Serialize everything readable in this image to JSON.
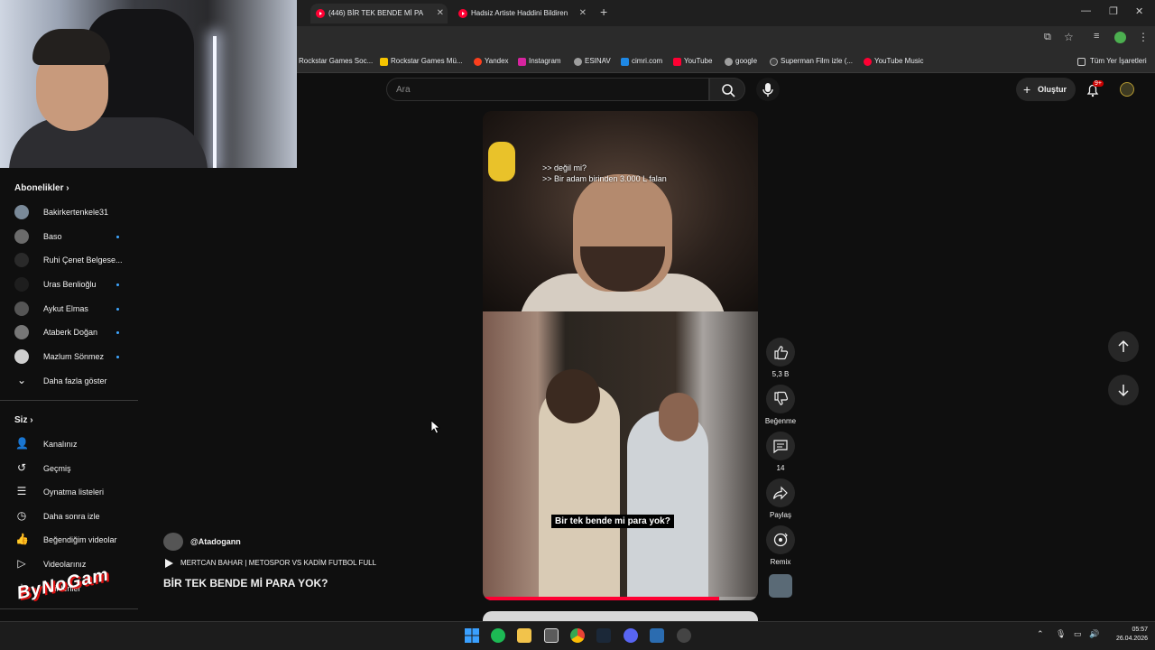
{
  "browser": {
    "tabs": [
      {
        "label": "(446) BİR TEK BENDE Mİ PA",
        "active": true
      },
      {
        "label": "Hadsiz Artiste Haddini Bildiren",
        "active": false
      }
    ],
    "bookmarks": [
      {
        "label": "Rockstar Games Soc...",
        "color": "#333333"
      },
      {
        "label": "Rockstar Games Mü...",
        "color": "#f5c400"
      },
      {
        "label": "Yandex",
        "color": "#fc3f1d"
      },
      {
        "label": "Instagram",
        "color": "#d6249f"
      },
      {
        "label": "ESINAV",
        "color": "#9e9e9e"
      },
      {
        "label": "cimri.com",
        "color": "#1e88e5"
      },
      {
        "label": "YouTube",
        "color": "#ff0033"
      },
      {
        "label": "google",
        "color": "#9e9e9e"
      },
      {
        "label": "Superman Film izle (...",
        "color": "#444444"
      },
      {
        "label": "YouTube Music",
        "color": "#ff0033"
      }
    ],
    "all_bookmarks": "Tüm Yer İşaretleri"
  },
  "sidebar": {
    "subscriptions_header": "Abonelikler",
    "subscriptions": [
      {
        "name": "Bakirkertenkele31",
        "new": false
      },
      {
        "name": "Baso",
        "new": true
      },
      {
        "name": "Ruhi Çenet Belgese...",
        "new": false
      },
      {
        "name": "Uras Benlioğlu",
        "new": true
      },
      {
        "name": "Aykut Elmas",
        "new": true
      },
      {
        "name": "Ataberk Doğan",
        "new": true
      },
      {
        "name": "Mazlum Sönmez",
        "new": true
      }
    ],
    "show_more": "Daha fazla göster",
    "you_header": "Siz",
    "you_items": [
      {
        "label": "Kanalınız",
        "icon": "channel-icon"
      },
      {
        "label": "Geçmiş",
        "icon": "history-icon"
      },
      {
        "label": "Oynatma listeleri",
        "icon": "playlists-icon"
      },
      {
        "label": "Daha sonra izle",
        "icon": "watch-later-icon"
      },
      {
        "label": "Beğendiğim videolar",
        "icon": "liked-icon"
      },
      {
        "label": "Videolarınız",
        "icon": "your-videos-icon"
      },
      {
        "label": "İndirilenler",
        "icon": "downloads-icon"
      }
    ]
  },
  "header": {
    "search_placeholder": "Ara",
    "create_label": "Oluştur",
    "notification_badge": "9+"
  },
  "video": {
    "caption_line1": ">> değil mi?",
    "caption_line2": ">> Bir adam birinden 3.000 L falan",
    "caption_bottom": "Bir tek bende mi para yok?",
    "progress": 0.86,
    "channel": "@Atadogann",
    "music": "MERTCAN BAHAR | METOSPOR VS KADİM FUTBOL FULL",
    "title": "BİR TEK BENDE Mİ PARA YOK?"
  },
  "actions": {
    "likes": "5,3 B",
    "dislike": "Beğenme",
    "comments": "14",
    "share": "Paylaş",
    "remix": "Remix"
  },
  "watermark": "ByNoGam",
  "taskbar": {
    "time": "05:57",
    "date": "26.04.2026"
  }
}
